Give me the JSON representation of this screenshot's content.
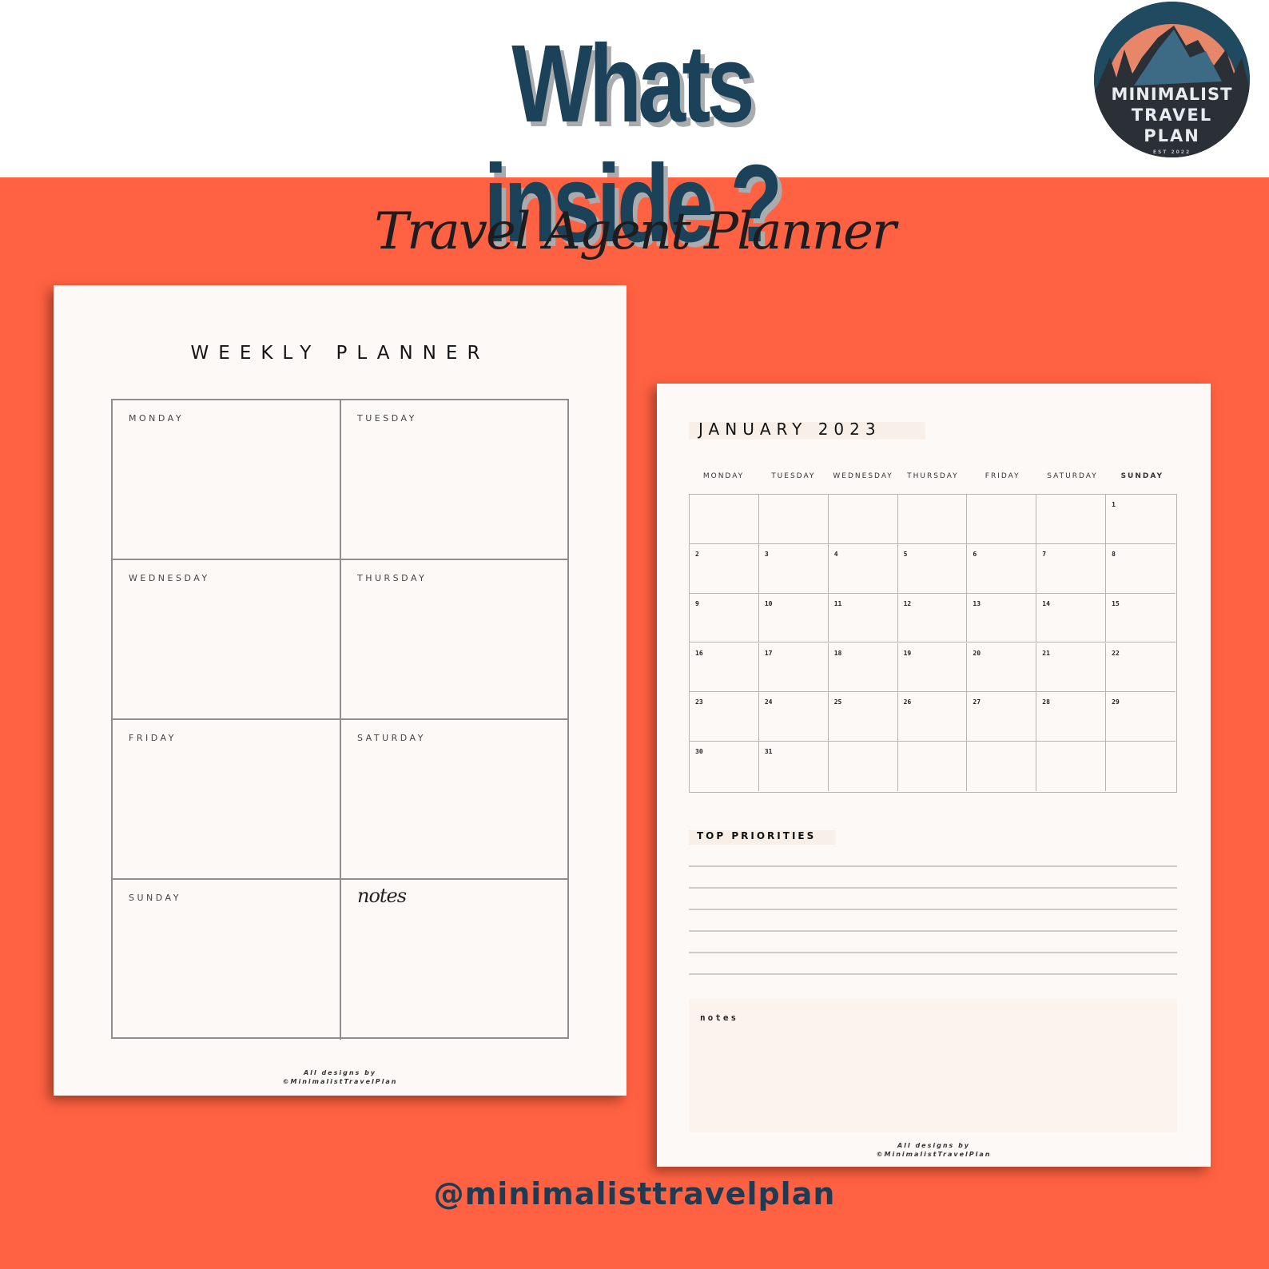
{
  "header": {
    "title": "Whats inside ?",
    "title_color": "#1c4259"
  },
  "logo": {
    "line1": "MINIMALIST",
    "line2": "TRAVEL",
    "line3": "PLAN",
    "est": "EST 2022"
  },
  "subtitle": "Travel Agent Planner",
  "weekly_planner": {
    "title": "WEEKLY PLANNER",
    "cells": [
      "MONDAY",
      "TUESDAY",
      "WEDNESDAY",
      "THURSDAY",
      "FRIDAY",
      "SATURDAY",
      "SUNDAY"
    ],
    "notes_label": "notes",
    "credit_line1": "All designs by",
    "credit_line2": "©MinimalistTravelPlan"
  },
  "monthly_planner": {
    "title": "JANUARY 2023",
    "weekdays": [
      "MONDAY",
      "TUESDAY",
      "WEDNESDAY",
      "THURSDAY",
      "FRIDAY",
      "SATURDAY",
      "SUNDAY"
    ],
    "weeks": [
      [
        "",
        "",
        "",
        "",
        "",
        "",
        "1"
      ],
      [
        "2",
        "3",
        "4",
        "5",
        "6",
        "7",
        "8"
      ],
      [
        "9",
        "10",
        "11",
        "12",
        "13",
        "14",
        "15"
      ],
      [
        "16",
        "17",
        "18",
        "19",
        "20",
        "21",
        "22"
      ],
      [
        "23",
        "24",
        "25",
        "26",
        "27",
        "28",
        "29"
      ],
      [
        "30",
        "31",
        "",
        "",
        "",
        "",
        ""
      ]
    ],
    "priorities_title": "TOP PRIORITIES",
    "priority_line_count": 6,
    "notes_label": "notes",
    "credit_line1": "All designs by",
    "credit_line2": "©MinimalistTravelPlan"
  },
  "footer": {
    "handle": "@minimalisttravelplan"
  },
  "colors": {
    "background_orange": "#ff6242",
    "navy": "#1c4259",
    "paper": "#fdf9f6"
  }
}
